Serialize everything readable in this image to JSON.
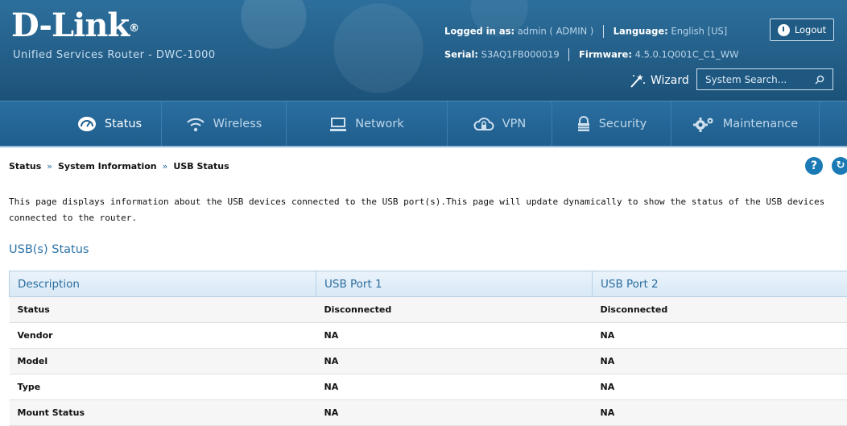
{
  "header": {
    "brand": "D-Link",
    "brand_mark": "®",
    "product": "Unified Services Router - DWC-1000",
    "logged_in_label": "Logged in as:",
    "logged_in_value": "admin ( ADMIN )",
    "language_label": "Language:",
    "language_value": "English [US]",
    "serial_label": "Serial:",
    "serial_value": "S3AQ1FB000019",
    "firmware_label": "Firmware:",
    "firmware_value": "4.5.0.1Q001C_C1_WW",
    "logout_label": "Logout",
    "wizard_label": "Wizard",
    "search_placeholder": "System Search..."
  },
  "nav": {
    "items": [
      {
        "label": "Status",
        "icon": "status-gauge-icon",
        "active": true
      },
      {
        "label": "Wireless",
        "icon": "wifi-icon",
        "active": false
      },
      {
        "label": "Network",
        "icon": "monitor-icon",
        "active": false
      },
      {
        "label": "VPN",
        "icon": "cloud-lock-icon",
        "active": false
      },
      {
        "label": "Security",
        "icon": "padlock-icon",
        "active": false
      },
      {
        "label": "Maintenance",
        "icon": "gears-icon",
        "active": false
      }
    ]
  },
  "breadcrumb": {
    "items": [
      "Status",
      "System Information",
      "USB Status"
    ],
    "separator": "»"
  },
  "page": {
    "description": "This page displays information about the USB devices connected to the USB port(s).This page will update dynamically to show the status of the USB devices connected to the router.",
    "section_title": "USB(s) Status"
  },
  "table": {
    "headers": [
      "Description",
      "USB Port 1",
      "USB Port 2"
    ],
    "rows": [
      [
        "Status",
        "Disconnected",
        "Disconnected"
      ],
      [
        "Vendor",
        "NA",
        "NA"
      ],
      [
        "Model",
        "NA",
        "NA"
      ],
      [
        "Type",
        "NA",
        "NA"
      ],
      [
        "Mount Status",
        "NA",
        "NA"
      ]
    ]
  },
  "colors": {
    "header_bg": "#1c5279",
    "nav_bg": "#1f5e8d",
    "accent": "#2b72a6",
    "help_icon": "#1a7ab6"
  }
}
